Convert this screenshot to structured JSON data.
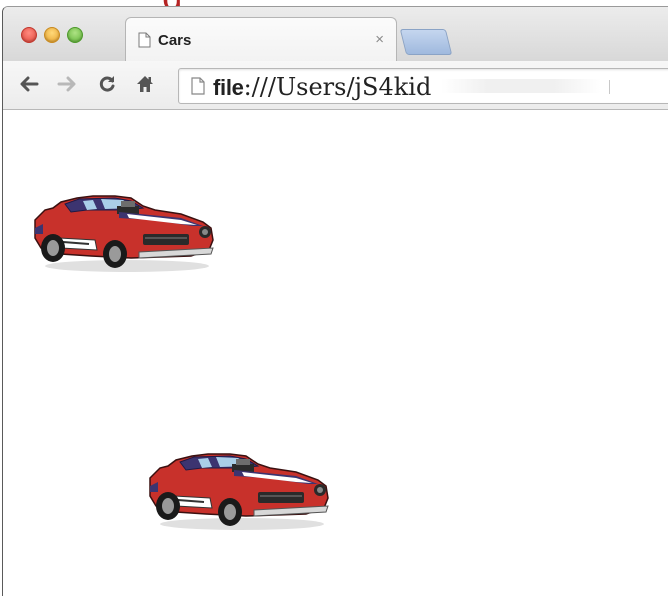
{
  "window": {
    "tab_title": "Cars",
    "tab_close": "×"
  },
  "toolbar": {
    "url_bold": "file",
    "url_sep": ":///",
    "url_rest": "Users/jS4",
    "url_tail": "kid"
  },
  "content": {
    "cars": [
      {
        "name": "car-1",
        "icon": "red-race-car"
      },
      {
        "name": "car-2",
        "icon": "red-race-car"
      }
    ]
  },
  "colors": {
    "car_body": "#c8312b",
    "car_stripe": "#3c3470",
    "brand_red": "#b52424"
  }
}
